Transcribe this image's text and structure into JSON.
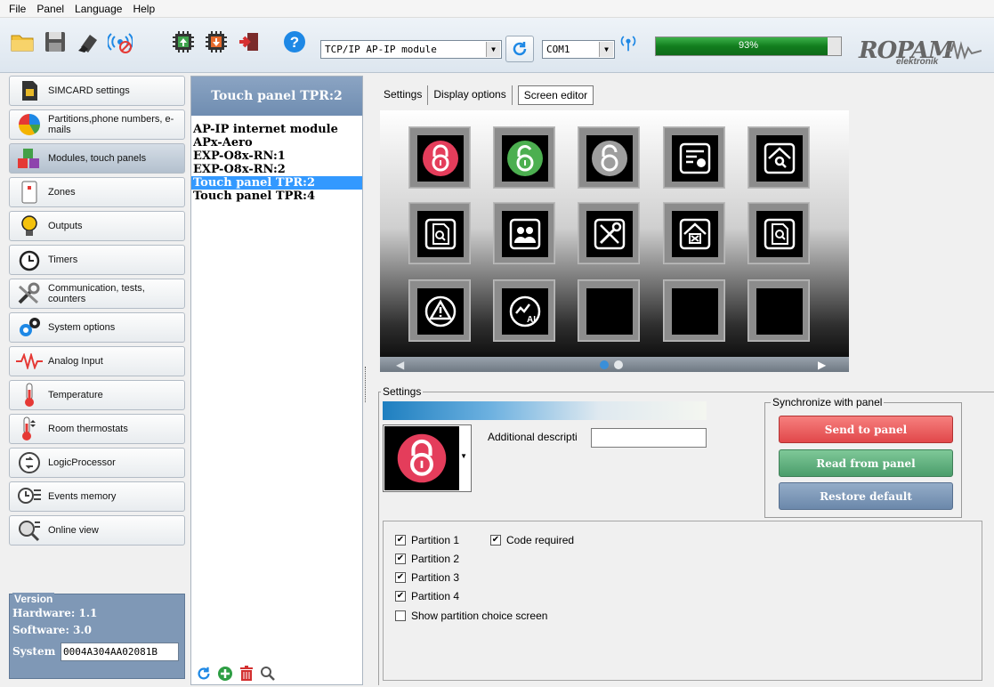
{
  "menu": [
    "File",
    "Panel",
    "Language",
    "Help"
  ],
  "toolbar": {
    "icons": [
      "open-folder-icon",
      "save-icon",
      "eraser-icon",
      "wireless-off-icon",
      "chip-upload-icon",
      "chip-download-icon",
      "exit-door-icon",
      "help-icon"
    ],
    "module_value": "TCP/IP AP-IP module",
    "com_value": "COM1",
    "progress_text": "93%",
    "progress_value": 0.93,
    "logo_brand": "ROPAM",
    "logo_sub": "elektronik"
  },
  "sidebar": {
    "items": [
      {
        "label": "SIMCARD settings",
        "icon": "simcard-icon"
      },
      {
        "label": "Partitions,phone numbers, e-mails",
        "icon": "pie-chart-icon"
      },
      {
        "label": "Modules, touch panels",
        "icon": "cubes-icon"
      },
      {
        "label": "Zones",
        "icon": "zone-sensor-icon"
      },
      {
        "label": "Outputs",
        "icon": "bulb-icon"
      },
      {
        "label": "Timers",
        "icon": "clock-icon"
      },
      {
        "label": "Communication, tests, counters",
        "icon": "tools-icon"
      },
      {
        "label": "System options",
        "icon": "gears-icon"
      },
      {
        "label": "Analog Input",
        "icon": "waveform-icon"
      },
      {
        "label": "Temperature",
        "icon": "thermometer-icon"
      },
      {
        "label": "Room thermostats",
        "icon": "thermostat-icon"
      },
      {
        "label": "LogicProcessor",
        "icon": "logic-icon"
      },
      {
        "label": "Events memory",
        "icon": "events-icon"
      },
      {
        "label": "Online view",
        "icon": "online-view-icon"
      }
    ],
    "active_index": 2,
    "version": {
      "legend": "Version",
      "hardware": "Hardware: 1.1",
      "software": "Software: 3.0",
      "system_label": "System",
      "system_value": "0004A304AA02081B"
    }
  },
  "devices": {
    "header": "Touch panel TPR:2",
    "items": [
      "AP-IP internet module",
      "APx-Aero",
      "EXP-O8x-RN:1",
      "EXP-O8x-RN:2",
      "Touch panel TPR:2",
      "Touch panel TPR:4"
    ],
    "selected_index": 4,
    "tools": [
      "refresh-icon",
      "add-icon",
      "delete-icon",
      "search-icon"
    ]
  },
  "tabs": [
    "Settings",
    "Display options",
    "Screen editor"
  ],
  "active_tab": 2,
  "editor": {
    "tiles": [
      "lock-closed-red-icon",
      "lock-open-green-icon",
      "lock-grey-icon",
      "notes-bulb-icon",
      "home-search-icon",
      "document-search-icon",
      "users-icon",
      "tools-icon",
      "home-cross-icon",
      "document-zoom-icon",
      "warning-icon",
      "analog-chart-icon",
      "empty",
      "empty",
      "empty"
    ],
    "page_count": 2,
    "current_page": 0
  },
  "settings": {
    "legend": "Settings",
    "description_label": "Additional descripti",
    "description_value": "",
    "selected_icon": "lock-closed-red-icon"
  },
  "sync": {
    "legend": "Synchronize with panel",
    "send": "Send to panel",
    "read": "Read from panel",
    "restore": "Restore default",
    "colors": {
      "send": "#e8575a",
      "read": "#5aaa7a",
      "restore": "#7793b6"
    }
  },
  "options": {
    "partitions": [
      {
        "label": "Partition 1",
        "checked": true
      },
      {
        "label": "Partition 2",
        "checked": true
      },
      {
        "label": "Partition 3",
        "checked": true
      },
      {
        "label": "Partition 4",
        "checked": true
      }
    ],
    "code_required": {
      "label": "Code required",
      "checked": true
    },
    "show_partition_choice": {
      "label": "Show partition choice screen",
      "checked": false
    }
  }
}
